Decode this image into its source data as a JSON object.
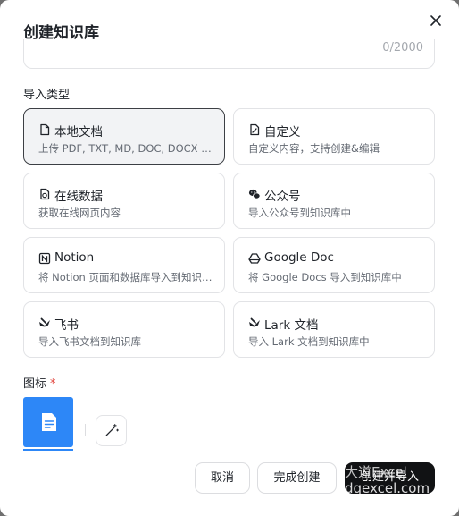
{
  "dialog": {
    "title": "创建知识库",
    "counter": "0/2000"
  },
  "import": {
    "label": "导入类型",
    "cards": [
      {
        "title": "本地文档",
        "desc": "上传 PDF, TXT, MD, DOC, DOCX 格式的本地文件",
        "icon": "file-icon",
        "selected": true
      },
      {
        "title": "自定义",
        "desc": "自定义内容，支持创建&编辑",
        "icon": "edit-file-icon",
        "selected": false
      },
      {
        "title": "在线数据",
        "desc": "获取在线网页内容",
        "icon": "web-file-icon",
        "selected": false
      },
      {
        "title": "公众号",
        "desc": "导入公众号到知识库中",
        "icon": "wechat-icon",
        "selected": false
      },
      {
        "title": "Notion",
        "desc": "将 Notion 页面和数据库导入到知识库中",
        "icon": "notion-icon",
        "selected": false
      },
      {
        "title": "Google Doc",
        "desc": "将 Google Docs 导入到知识库中",
        "icon": "google-drive-icon",
        "selected": false
      },
      {
        "title": "飞书",
        "desc": "导入飞书文档到知识库",
        "icon": "feishu-icon",
        "selected": false
      },
      {
        "title": "Lark 文档",
        "desc": "导入 Lark 文档到知识库中",
        "icon": "lark-icon",
        "selected": false
      }
    ]
  },
  "icon_field": {
    "label": "图标",
    "required_mark": "*"
  },
  "buttons": {
    "cancel": "取消",
    "finish": "完成创建",
    "create": "创建并导入"
  },
  "watermark": {
    "line1": "大道Excel",
    "line2": "dqexcel.com"
  },
  "colors": {
    "accent": "#2d87f7",
    "primary_button": "#111214",
    "required": "#e0423a"
  }
}
